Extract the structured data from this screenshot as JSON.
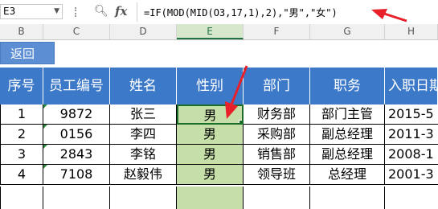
{
  "formula_bar": {
    "cell_ref": "E3",
    "formula": "=IF(MOD(MID(O3,17,1),2),\"男\",\"女\")"
  },
  "columns": [
    "B",
    "C",
    "D",
    "E",
    "F",
    "G",
    "H"
  ],
  "back_button": "返回",
  "headers": [
    "序号",
    "员工编号",
    "姓名",
    "性别",
    "部门",
    "职务",
    "入职日期"
  ],
  "rows": [
    [
      "1",
      "9872",
      "张三",
      "男",
      "财务部",
      "部门主管",
      "2015-5"
    ],
    [
      "2",
      "0156",
      "李四",
      "男",
      "采购部",
      "副总经理",
      "2011-3"
    ],
    [
      "3",
      "2843",
      "李铭",
      "男",
      "销售部",
      "副总经理",
      "2008-1"
    ],
    [
      "4",
      "7108",
      "赵毅伟",
      "男",
      "领导班",
      "总经理",
      "2001-3"
    ]
  ],
  "colors": {
    "header_blue": "#3d79c9",
    "gender_fill": "#c6dfa8",
    "annotation_red": "#e8202a"
  }
}
